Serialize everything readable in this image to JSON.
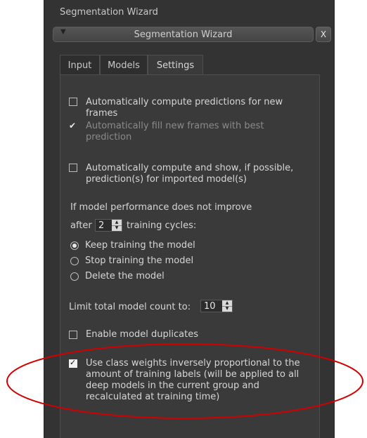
{
  "panel": {
    "title": "Segmentation Wizard",
    "collapse_label": "Segmentation Wizard",
    "close_label": "X"
  },
  "tabs": [
    {
      "label": "Input",
      "active": false
    },
    {
      "label": "Models",
      "active": false
    },
    {
      "label": "Settings",
      "active": true
    }
  ],
  "settings": {
    "auto_compute": {
      "line1": "Automatically compute predictions for new",
      "line2": "frames",
      "checked": false
    },
    "auto_fill": {
      "line1": "Automatically fill new frames with best",
      "line2": "prediction",
      "checked": true,
      "disabled": true
    },
    "auto_show": {
      "line1": "Automatically compute and show, if possible,",
      "line2": "prediction(s) for imported model(s)",
      "checked": false
    },
    "performance_heading": "If model performance does not improve",
    "after_label": "after",
    "after_value": "2",
    "cycles_label": "training cycles:",
    "radio_options": [
      {
        "label": "Keep training the model",
        "selected": true
      },
      {
        "label": "Stop training the model",
        "selected": false
      },
      {
        "label": "Delete the model",
        "selected": false
      }
    ],
    "limit_label": "Limit total model count to:",
    "limit_value": "10",
    "duplicates": {
      "label": "Enable model duplicates",
      "checked": false
    },
    "class_weights": {
      "line1": "Use class weights inversely proportional to the",
      "line2": "amount of training labels (will be applied to all",
      "line3": "deep models in the current group and",
      "line4": "recalculated at training time)",
      "checked": true
    }
  },
  "colors": {
    "panel_bg": "#333333",
    "content_bg": "#3a3a3a",
    "annotation": "#d40000"
  }
}
